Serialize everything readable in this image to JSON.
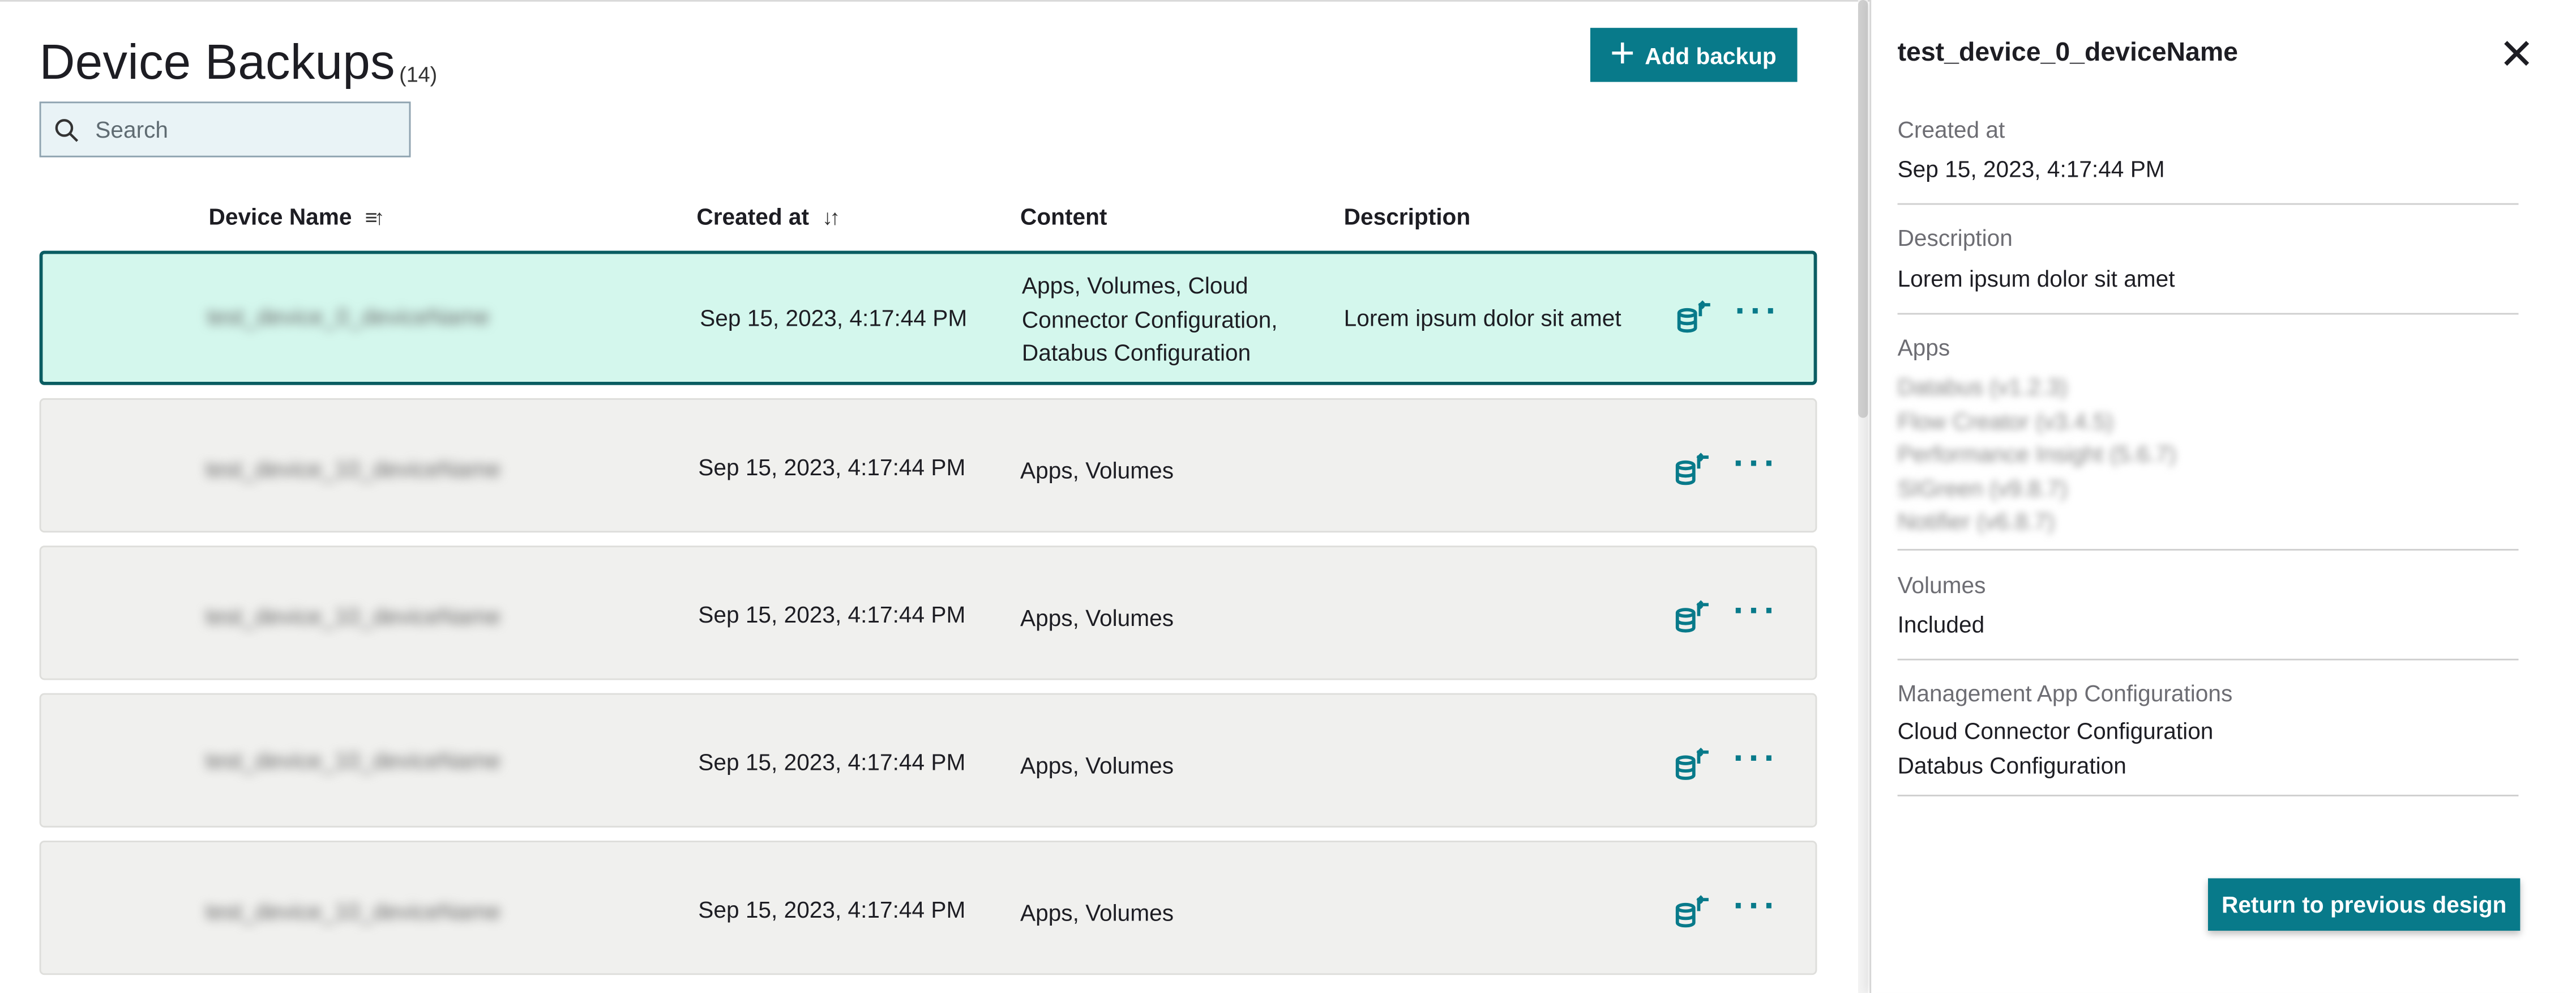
{
  "header": {
    "title": "Device Backups",
    "count": "(14)",
    "add_label": "Add backup"
  },
  "search": {
    "placeholder": "Search"
  },
  "columns": {
    "device_name": "Device Name",
    "created_at": "Created at",
    "content": "Content",
    "description": "Description"
  },
  "rows": [
    {
      "device": "test_device_0_deviceName",
      "created": "Sep 15, 2023, 4:17:44 PM",
      "content_lines": [
        "Apps, Volumes, Cloud",
        "Connector Configuration,",
        "Databus Configuration"
      ],
      "description": "Lorem ipsum dolor sit amet",
      "selected": true
    },
    {
      "device": "test_device_10_deviceName",
      "created": "Sep 15, 2023, 4:17:44 PM",
      "content_lines": [
        "Apps, Volumes"
      ],
      "description": ""
    },
    {
      "device": "test_device_10_deviceName",
      "created": "Sep 15, 2023, 4:17:44 PM",
      "content_lines": [
        "Apps, Volumes"
      ],
      "description": ""
    },
    {
      "device": "test_device_10_deviceName",
      "created": "Sep 15, 2023, 4:17:44 PM",
      "content_lines": [
        "Apps, Volumes"
      ],
      "description": ""
    },
    {
      "device": "test_device_10_deviceName",
      "created": "Sep 15, 2023, 4:17:44 PM",
      "content_lines": [
        "Apps, Volumes"
      ],
      "description": ""
    }
  ],
  "panel": {
    "title": "test_device_0_deviceName",
    "created_label": "Created at",
    "created_value": "Sep 15, 2023, 4:17:44 PM",
    "description_label": "Description",
    "description_value": "Lorem ipsum dolor sit amet",
    "apps_label": "Apps",
    "apps": [
      "Databus (v1.2.3)",
      "Flow Creator (v3.4.5)",
      "Performance Insight (5.6.7)",
      "SIGreen (v9.8.7)",
      "Notifier (v6.8.7)"
    ],
    "volumes_label": "Volumes",
    "volumes_value": "Included",
    "mgmt_label": "Management App Configurations",
    "mgmt": [
      "Cloud Connector Configuration",
      "Databus Configuration"
    ],
    "return_label": "Return to previous design"
  },
  "icons": {
    "add": "plus-icon",
    "search": "search-icon",
    "sort_name": "sort-ascending-icon",
    "sort_date": "sort-descending-icon",
    "restore": "database-restore-icon",
    "more": "more-dots-icon",
    "close": "close-icon"
  },
  "colors": {
    "accent": "#087a8a",
    "selected_row": "#d4f7ed",
    "selected_border": "#0a5d62",
    "row_bg": "#f0f0ee"
  }
}
